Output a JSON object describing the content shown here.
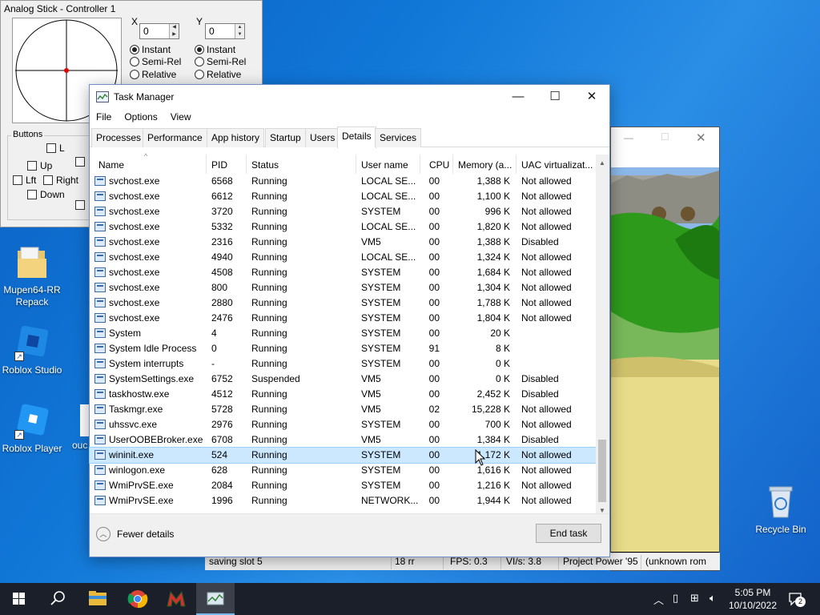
{
  "desktop": {
    "icons": [
      {
        "label": "Mupen64-RR Repack"
      },
      {
        "label": "Roblox Studio"
      },
      {
        "label": "Roblox Player"
      },
      {
        "label": "ouc"
      },
      {
        "label": "Recycle Bin"
      }
    ]
  },
  "analog": {
    "title": "Analog Stick - Controller 1",
    "x_label": "X",
    "y_label": "Y",
    "x_value": "0",
    "y_value": "0",
    "modes": [
      "Instant",
      "Semi-Rel",
      "Relative"
    ],
    "buttons_label": "Buttons",
    "buttons": [
      "L",
      "Up",
      "Lft",
      "Right",
      "Down"
    ]
  },
  "game_status": {
    "message": "saving slot 5",
    "rr": "18 rr",
    "fps": "FPS: 0.3",
    "vis": "VI/s: 3.8",
    "rom": "Project Power '95",
    "extra": "(unknown rom"
  },
  "taskmanager": {
    "title": "Task Manager",
    "menu": [
      "File",
      "Options",
      "View"
    ],
    "tabs": [
      "Processes",
      "Performance",
      "App history",
      "Startup",
      "Users",
      "Details",
      "Services"
    ],
    "active_tab": "Details",
    "columns": [
      "Name",
      "PID",
      "Status",
      "User name",
      "CPU",
      "Memory (a...",
      "UAC virtualizat..."
    ],
    "rows": [
      {
        "name": "svchost.exe",
        "pid": "6568",
        "status": "Running",
        "user": "LOCAL SE...",
        "cpu": "00",
        "mem": "1,388 K",
        "uac": "Not allowed"
      },
      {
        "name": "svchost.exe",
        "pid": "6612",
        "status": "Running",
        "user": "LOCAL SE...",
        "cpu": "00",
        "mem": "1,100 K",
        "uac": "Not allowed"
      },
      {
        "name": "svchost.exe",
        "pid": "3720",
        "status": "Running",
        "user": "SYSTEM",
        "cpu": "00",
        "mem": "996 K",
        "uac": "Not allowed"
      },
      {
        "name": "svchost.exe",
        "pid": "5332",
        "status": "Running",
        "user": "LOCAL SE...",
        "cpu": "00",
        "mem": "1,820 K",
        "uac": "Not allowed"
      },
      {
        "name": "svchost.exe",
        "pid": "2316",
        "status": "Running",
        "user": "VM5",
        "cpu": "00",
        "mem": "1,388 K",
        "uac": "Disabled"
      },
      {
        "name": "svchost.exe",
        "pid": "4940",
        "status": "Running",
        "user": "LOCAL SE...",
        "cpu": "00",
        "mem": "1,324 K",
        "uac": "Not allowed"
      },
      {
        "name": "svchost.exe",
        "pid": "4508",
        "status": "Running",
        "user": "SYSTEM",
        "cpu": "00",
        "mem": "1,684 K",
        "uac": "Not allowed"
      },
      {
        "name": "svchost.exe",
        "pid": "800",
        "status": "Running",
        "user": "SYSTEM",
        "cpu": "00",
        "mem": "1,304 K",
        "uac": "Not allowed"
      },
      {
        "name": "svchost.exe",
        "pid": "2880",
        "status": "Running",
        "user": "SYSTEM",
        "cpu": "00",
        "mem": "1,788 K",
        "uac": "Not allowed"
      },
      {
        "name": "svchost.exe",
        "pid": "2476",
        "status": "Running",
        "user": "SYSTEM",
        "cpu": "00",
        "mem": "1,804 K",
        "uac": "Not allowed"
      },
      {
        "name": "System",
        "pid": "4",
        "status": "Running",
        "user": "SYSTEM",
        "cpu": "00",
        "mem": "20 K",
        "uac": ""
      },
      {
        "name": "System Idle Process",
        "pid": "0",
        "status": "Running",
        "user": "SYSTEM",
        "cpu": "91",
        "mem": "8 K",
        "uac": ""
      },
      {
        "name": "System interrupts",
        "pid": "-",
        "status": "Running",
        "user": "SYSTEM",
        "cpu": "00",
        "mem": "0 K",
        "uac": ""
      },
      {
        "name": "SystemSettings.exe",
        "pid": "6752",
        "status": "Suspended",
        "user": "VM5",
        "cpu": "00",
        "mem": "0 K",
        "uac": "Disabled"
      },
      {
        "name": "taskhostw.exe",
        "pid": "4512",
        "status": "Running",
        "user": "VM5",
        "cpu": "00",
        "mem": "2,452 K",
        "uac": "Disabled"
      },
      {
        "name": "Taskmgr.exe",
        "pid": "5728",
        "status": "Running",
        "user": "VM5",
        "cpu": "02",
        "mem": "15,228 K",
        "uac": "Not allowed"
      },
      {
        "name": "uhssvc.exe",
        "pid": "2976",
        "status": "Running",
        "user": "SYSTEM",
        "cpu": "00",
        "mem": "700 K",
        "uac": "Not allowed"
      },
      {
        "name": "UserOOBEBroker.exe",
        "pid": "6708",
        "status": "Running",
        "user": "VM5",
        "cpu": "00",
        "mem": "1,384 K",
        "uac": "Disabled"
      },
      {
        "name": "wininit.exe",
        "pid": "524",
        "status": "Running",
        "user": "SYSTEM",
        "cpu": "00",
        "mem": "1,172 K",
        "uac": "Not allowed"
      },
      {
        "name": "winlogon.exe",
        "pid": "628",
        "status": "Running",
        "user": "SYSTEM",
        "cpu": "00",
        "mem": "1,616 K",
        "uac": "Not allowed"
      },
      {
        "name": "WmiPrvSE.exe",
        "pid": "2084",
        "status": "Running",
        "user": "SYSTEM",
        "cpu": "00",
        "mem": "1,216 K",
        "uac": "Not allowed"
      },
      {
        "name": "WmiPrvSE.exe",
        "pid": "1996",
        "status": "Running",
        "user": "NETWORK...",
        "cpu": "00",
        "mem": "1,944 K",
        "uac": "Not allowed"
      }
    ],
    "selected_row": "wininit.exe",
    "fewer_details": "Fewer details",
    "end_task": "End task"
  },
  "taskbar": {
    "time": "5:05 PM",
    "date": "10/10/2022",
    "notifications": "2",
    "pinned": [
      "start-icon",
      "search-icon",
      "file-explorer-icon",
      "chrome-icon",
      "mupen64-icon",
      "task-manager-icon"
    ]
  },
  "colors": {
    "accent": "#0078d7",
    "selection": "#cce8ff",
    "taskbar": "#1a1f2a"
  }
}
